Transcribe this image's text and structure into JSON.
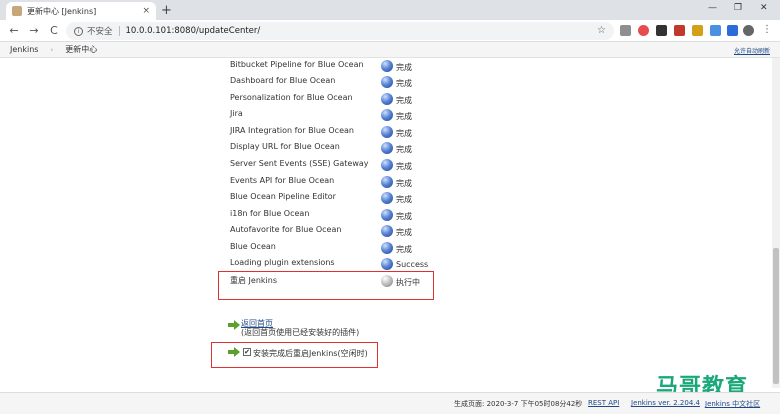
{
  "browser": {
    "tab_title": "更新中心 [Jenkins]",
    "tab_close": "×",
    "new_tab": "+",
    "back": "←",
    "forward": "→",
    "reload": "C",
    "security_label": "不安全",
    "url": "10.0.0.101:8080/updateCenter/",
    "bookmark": "☆",
    "minimize": "—",
    "maximize": "❐",
    "close": "✕"
  },
  "breadcrumb": {
    "items": [
      "Jenkins",
      "更新中心"
    ],
    "separator": "›",
    "auto_refresh": "允许自动刷新"
  },
  "plugins": [
    {
      "name": "Bitbucket Pipeline for Blue Ocean",
      "status": "完成"
    },
    {
      "name": "Dashboard for Blue Ocean",
      "status": "完成"
    },
    {
      "name": "Personalization for Blue Ocean",
      "status": "完成"
    },
    {
      "name": "Jira",
      "status": "完成"
    },
    {
      "name": "JIRA Integration for Blue Ocean",
      "status": "完成"
    },
    {
      "name": "Display URL for Blue Ocean",
      "status": "完成"
    },
    {
      "name": "Server Sent Events (SSE) Gateway",
      "status": "完成"
    },
    {
      "name": "Events API for Blue Ocean",
      "status": "完成"
    },
    {
      "name": "Blue Ocean Pipeline Editor",
      "status": "完成"
    },
    {
      "name": "i18n for Blue Ocean",
      "status": "完成"
    },
    {
      "name": "Autofavorite for Blue Ocean",
      "status": "完成"
    },
    {
      "name": "Blue Ocean",
      "status": "完成"
    },
    {
      "name": "Loading plugin extensions",
      "status": "Success"
    }
  ],
  "restart": {
    "name": "重启 Jenkins",
    "status": "执行中"
  },
  "actions": {
    "back_link": "返回首页",
    "back_desc": "(返回首页使用已经安装好的插件)",
    "restart_checkbox_label": "安装完成后重启Jenkins(空闲时)",
    "restart_checked": true,
    "check_mark": "✔"
  },
  "footer": {
    "generated": "生成页面: 2020-3-7 下午05时08分42秒",
    "rest_api": "REST API",
    "version": "Jenkins ver. 2.204.4",
    "community": "Jenkins 中文社区"
  },
  "watermark": "马哥教育",
  "colors": {
    "accent": "#204a87",
    "highlight": "#e03030",
    "arrow": "#5aa02c",
    "watermark": "#1aa77a"
  }
}
